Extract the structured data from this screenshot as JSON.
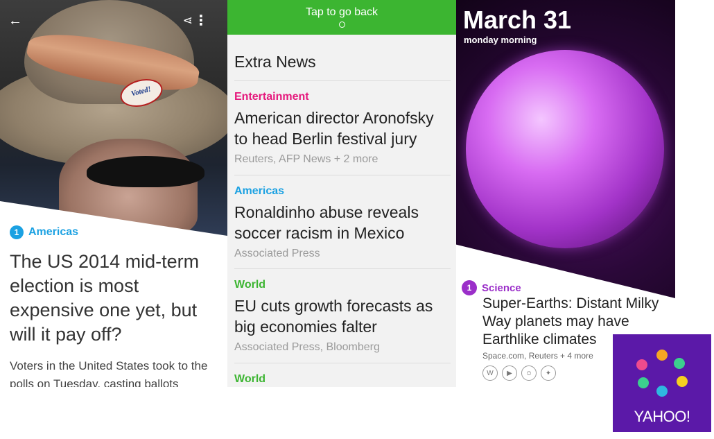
{
  "panel1": {
    "pin_text": "Voted!",
    "badge_number": "1",
    "category": "Americas",
    "headline": "The US 2014 mid-term election is most expensive one yet, but will it pay off?",
    "summary": "Voters in the United States took to the polls on Tuesday, casting ballots",
    "icons": [
      "back-arrow",
      "share",
      "more-vertical"
    ]
  },
  "panel2": {
    "tap_bar": "Tap to go back",
    "section_title": "Extra News",
    "items": [
      {
        "category": "Entertainment",
        "color": "#e5187c",
        "headline": "American director Aronofsky to head Berlin festival jury",
        "sources": "Reuters, AFP News + 2 more"
      },
      {
        "category": "Americas",
        "color": "#1ba1e2",
        "headline": "Ronaldinho abuse reveals soccer racism in Mexico",
        "sources": "Associated Press"
      },
      {
        "category": "World",
        "color": "#3cb531",
        "headline": "EU cuts growth forecasts as big economies falter",
        "sources": "Associated Press, Bloomberg"
      },
      {
        "category": "World",
        "color": "#3cb531",
        "headline": "",
        "sources": ""
      }
    ]
  },
  "panel3": {
    "date": "March 31",
    "daypart": "monday morning",
    "badge_number": "1",
    "category": "Science",
    "headline": "Super-Earths: Distant Milky Way planets may have Earthlike climates",
    "sources": "Space.com, Reuters + 4 more",
    "share_icons": [
      "wikipedia",
      "video",
      "photos",
      "twitter"
    ]
  },
  "logo": {
    "wordmark": "YAHOO!",
    "dot_colors": [
      "#f5a623",
      "#3ccf8e",
      "#f5d020",
      "#f5a623",
      "#2fb8e0",
      "#3ccf8e",
      "#ef4b8d",
      "#ef4b8d"
    ]
  }
}
